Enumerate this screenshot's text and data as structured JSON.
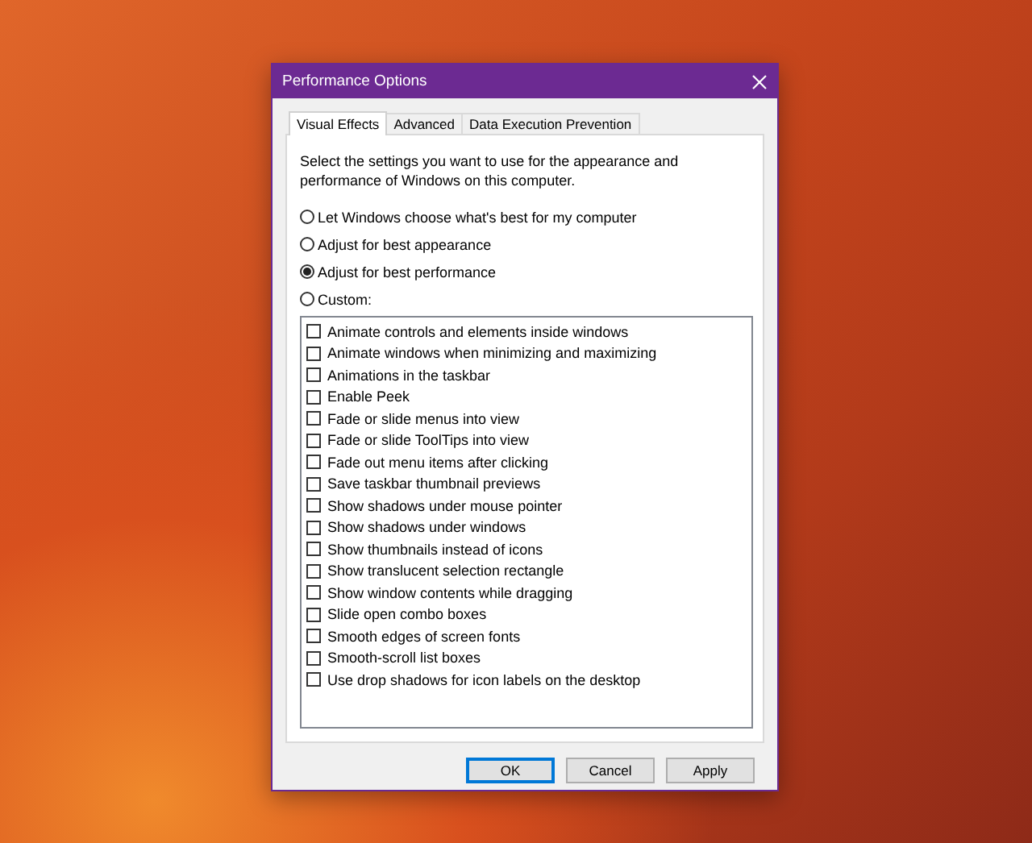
{
  "window": {
    "title": "Performance Options"
  },
  "tabs": [
    {
      "label": "Visual Effects",
      "selected": true
    },
    {
      "label": "Advanced",
      "selected": false
    },
    {
      "label": "Data Execution Prevention",
      "selected": false
    }
  ],
  "intro": "Select the settings you want to use for the appearance and performance of Windows on this computer.",
  "options": [
    {
      "label": "Let Windows choose what's best for my computer",
      "selected": false
    },
    {
      "label": "Adjust for best appearance",
      "selected": false
    },
    {
      "label": "Adjust for best performance",
      "selected": true
    },
    {
      "label": "Custom:",
      "selected": false
    }
  ],
  "effects": [
    {
      "label": "Animate controls and elements inside windows",
      "checked": false
    },
    {
      "label": "Animate windows when minimizing and maximizing",
      "checked": false
    },
    {
      "label": "Animations in the taskbar",
      "checked": false
    },
    {
      "label": "Enable Peek",
      "checked": false
    },
    {
      "label": "Fade or slide menus into view",
      "checked": false
    },
    {
      "label": "Fade or slide ToolTips into view",
      "checked": false
    },
    {
      "label": "Fade out menu items after clicking",
      "checked": false
    },
    {
      "label": "Save taskbar thumbnail previews",
      "checked": false
    },
    {
      "label": "Show shadows under mouse pointer",
      "checked": false
    },
    {
      "label": "Show shadows under windows",
      "checked": false
    },
    {
      "label": "Show thumbnails instead of icons",
      "checked": false
    },
    {
      "label": "Show translucent selection rectangle",
      "checked": false
    },
    {
      "label": "Show window contents while dragging",
      "checked": false
    },
    {
      "label": "Slide open combo boxes",
      "checked": false
    },
    {
      "label": "Smooth edges of screen fonts",
      "checked": false
    },
    {
      "label": "Smooth-scroll list boxes",
      "checked": false
    },
    {
      "label": "Use drop shadows for icon labels on the desktop",
      "checked": false
    }
  ],
  "buttons": [
    {
      "label": "OK",
      "kind": "default"
    },
    {
      "label": "Cancel",
      "kind": "normal"
    },
    {
      "label": "Apply",
      "kind": "normal"
    }
  ]
}
